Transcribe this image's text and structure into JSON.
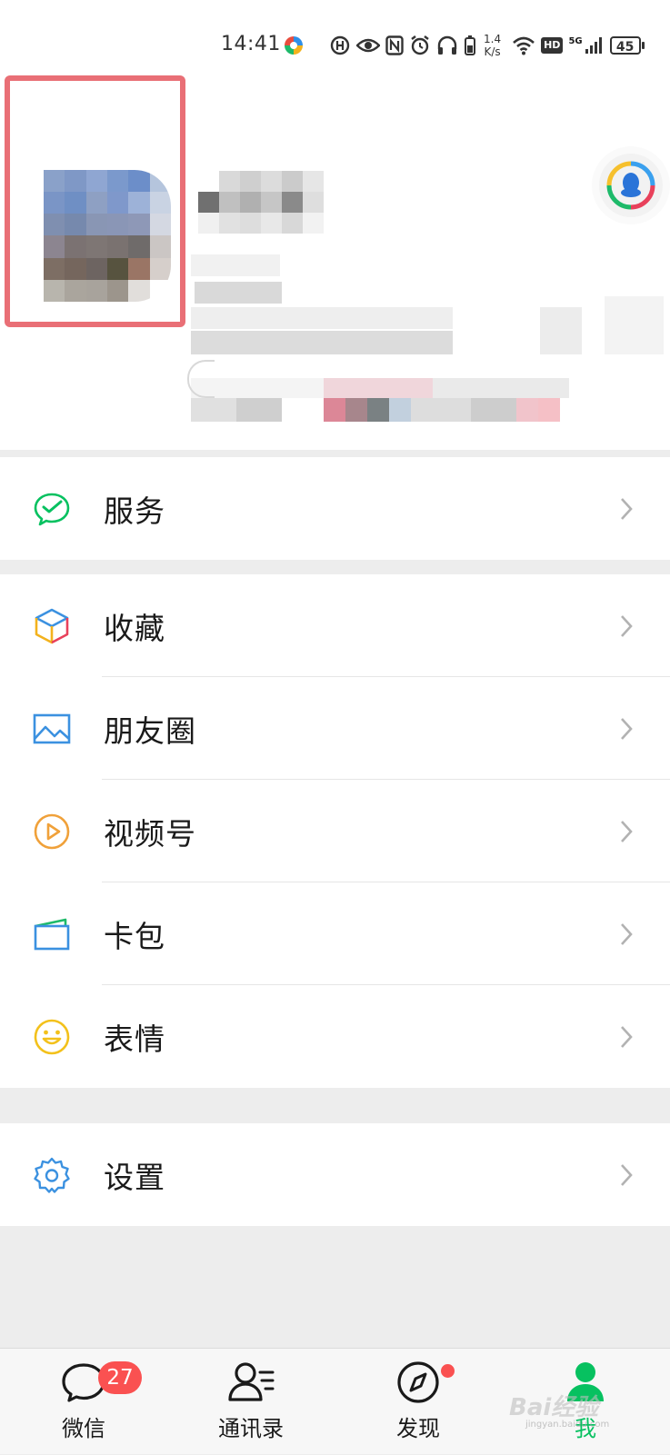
{
  "status_bar": {
    "time": "14:41",
    "net_speed_value": "1.4",
    "net_speed_unit": "K/s",
    "network_type": "5G",
    "hd_label": "HD",
    "battery": "45"
  },
  "profile": {
    "avatar_state": "pixelated",
    "nickname_state": "pixelated",
    "highlight_color": "#e96f76"
  },
  "menu": {
    "service": {
      "label": "服务",
      "icon": "wechat-pay-icon"
    },
    "favorites": {
      "label": "收藏",
      "icon": "cube-icon"
    },
    "moments": {
      "label": "朋友圈",
      "icon": "image-icon"
    },
    "channels": {
      "label": "视频号",
      "icon": "play-icon"
    },
    "cards": {
      "label": "卡包",
      "icon": "wallet-icon"
    },
    "stickers": {
      "label": "表情",
      "icon": "smile-icon"
    },
    "settings": {
      "label": "设置",
      "icon": "gear-icon"
    }
  },
  "tabs": {
    "chats": {
      "label": "微信",
      "badge": "27",
      "icon": "chat-bubble-icon"
    },
    "contacts": {
      "label": "通讯录",
      "icon": "contacts-icon"
    },
    "discover": {
      "label": "发现",
      "icon": "compass-icon"
    },
    "me": {
      "label": "我",
      "icon": "person-icon",
      "active": true
    }
  },
  "watermark": {
    "text": "Bai经验",
    "sub": "jingyan.baidu.com"
  },
  "colors": {
    "accent_green": "#07c160",
    "badge_red": "#fa5151",
    "background": "#ededed"
  }
}
